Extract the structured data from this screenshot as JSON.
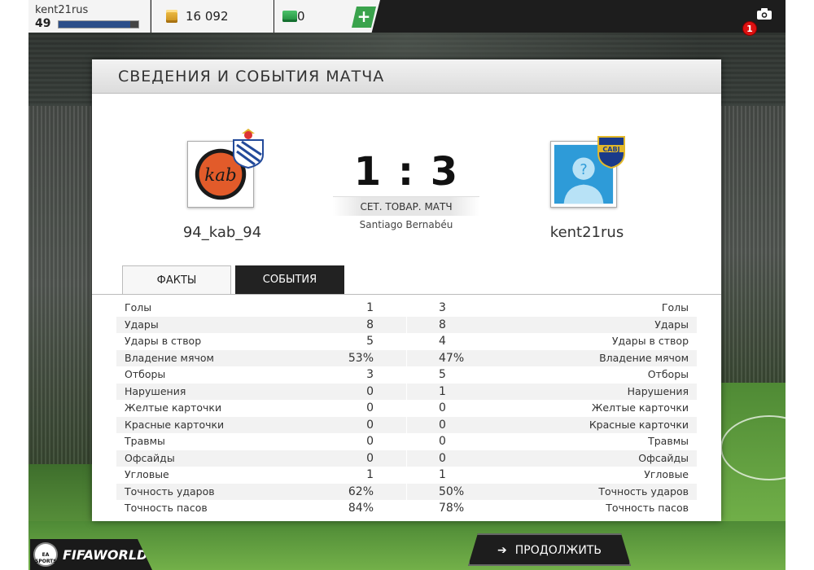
{
  "user": {
    "name": "kent21rus",
    "level": "49",
    "xp_fraction": 0.9
  },
  "currency": {
    "coins": "16 092",
    "points": "0",
    "add_label": "+"
  },
  "notifications": {
    "count": "1"
  },
  "panel": {
    "title": "СВЕДЕНИЯ И СОБЫТИЯ МАТЧА"
  },
  "match": {
    "home_team": "94_kab_94",
    "away_team": "kent21rus",
    "score": "1 : 3",
    "type": "СЕТ. ТОВАР. МАТЧ",
    "stadium": "Santiago Bernabéu",
    "home_logo_text": "kab"
  },
  "tabs": {
    "facts": "ФАКТЫ",
    "events": "СОБЫТИЯ"
  },
  "stats": [
    {
      "label": "Голы",
      "home": "1",
      "away": "3"
    },
    {
      "label": "Удары",
      "home": "8",
      "away": "8"
    },
    {
      "label": "Удары в створ",
      "home": "5",
      "away": "4"
    },
    {
      "label": "Владение мячом",
      "home": "53%",
      "away": "47%"
    },
    {
      "label": "Отборы",
      "home": "3",
      "away": "5"
    },
    {
      "label": "Нарушения",
      "home": "0",
      "away": "1"
    },
    {
      "label": "Желтые карточки",
      "home": "0",
      "away": "0"
    },
    {
      "label": "Красные карточки",
      "home": "0",
      "away": "0"
    },
    {
      "label": "Травмы",
      "home": "0",
      "away": "0"
    },
    {
      "label": "Офсайды",
      "home": "0",
      "away": "0"
    },
    {
      "label": "Угловые",
      "home": "1",
      "away": "1"
    },
    {
      "label": "Точность ударов",
      "home": "62%",
      "away": "50%"
    },
    {
      "label": "Точность пасов",
      "home": "84%",
      "away": "78%"
    }
  ],
  "footer": {
    "continue_label": "ПРОДОЛЖИТЬ",
    "brand": "FIFAWORLD",
    "ea_label": "EA SPORTS"
  },
  "colors": {
    "accent_green": "#3aa34c",
    "dark": "#1d1d1d",
    "notif_red": "#dd1111"
  }
}
